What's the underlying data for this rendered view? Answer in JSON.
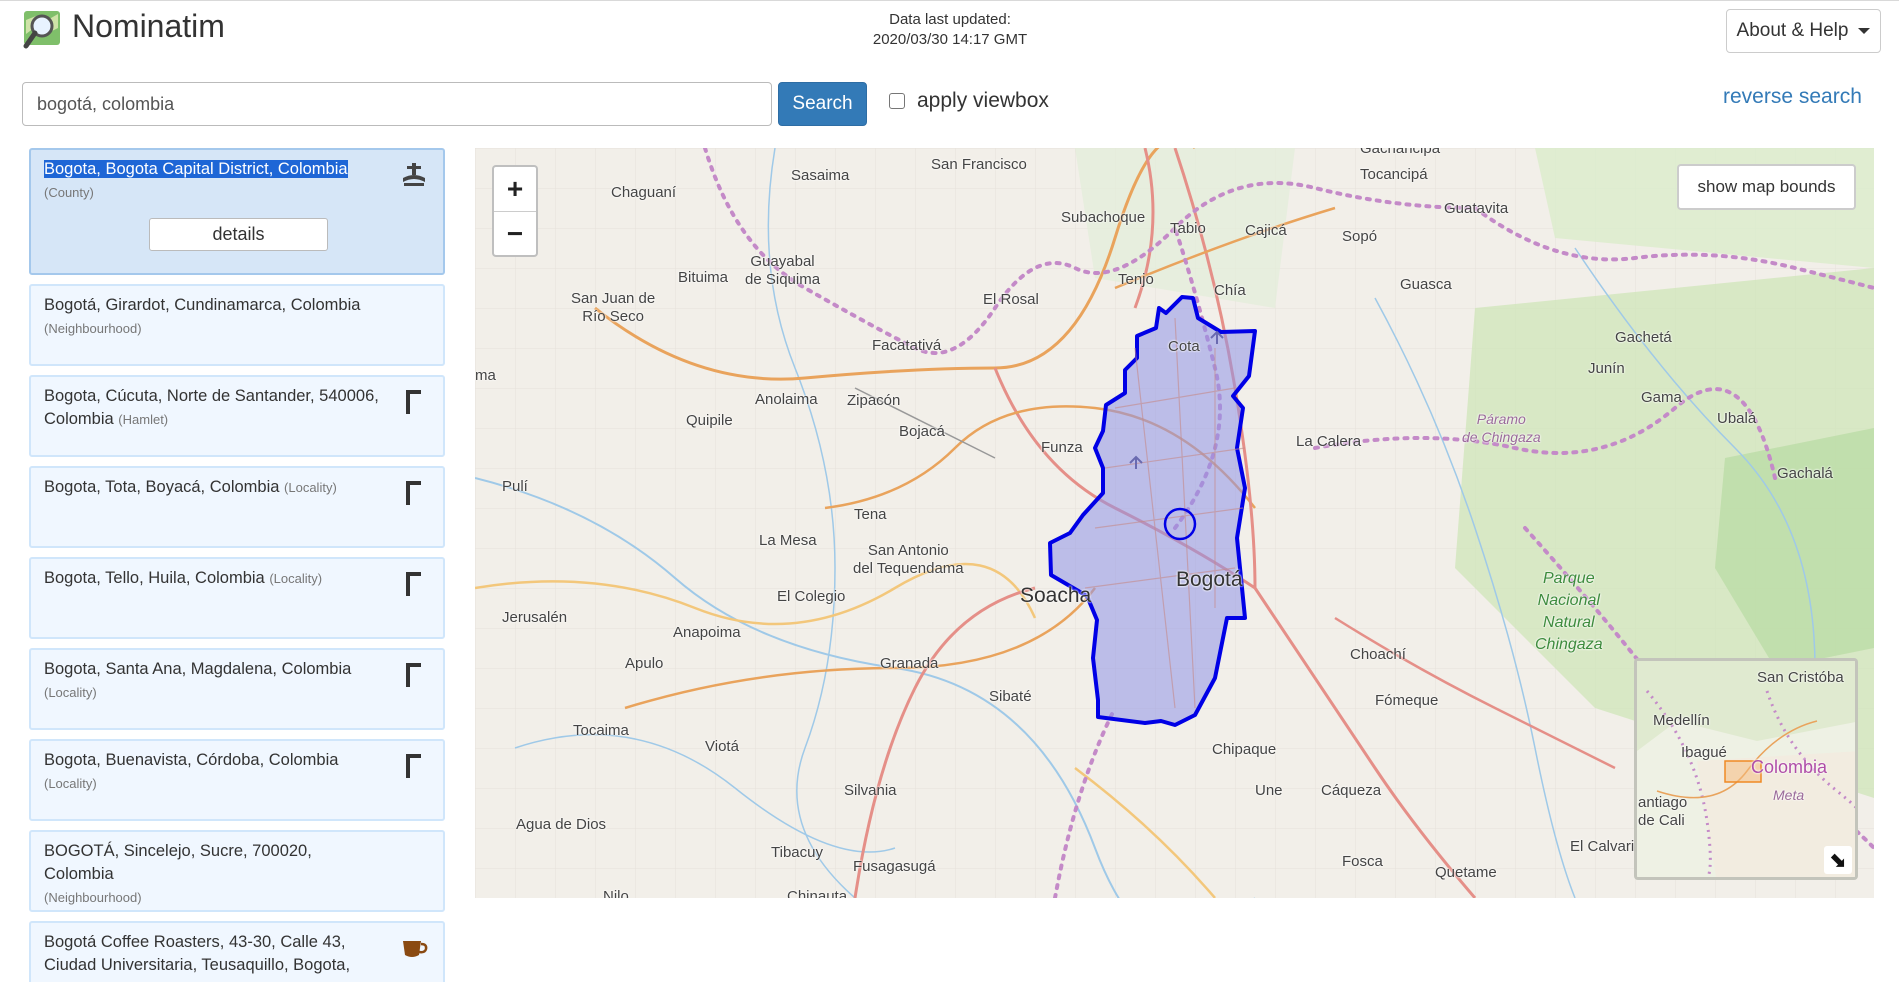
{
  "header": {
    "brand": "Nominatim",
    "updated_line1": "Data last updated:",
    "updated_line2": "2020/03/30 14:17 GMT",
    "about_label": "About & Help"
  },
  "search": {
    "query": "bogotá, colombia",
    "button_label": "Search",
    "viewbox_label": "apply viewbox",
    "viewbox_checked": false,
    "reverse_label": "reverse search"
  },
  "results": [
    {
      "name": "Bogota, Bogota Capital District, Colombia",
      "type": "(County)",
      "icon": "boundary-icon",
      "selected": true,
      "details_label": "details"
    },
    {
      "name": "Bogotá, Girardot, Cundinamarca, Colombia",
      "type": "(Neighbourhood)",
      "icon": ""
    },
    {
      "name": "Bogota, Cúcuta, Norte de Santander, 540006, Colombia",
      "type": "(Hamlet)",
      "icon": "place-flag-icon"
    },
    {
      "name": "Bogota, Tota, Boyacá, Colombia",
      "type": "(Locality)",
      "icon": "place-flag-icon"
    },
    {
      "name": "Bogota, Tello, Huila, Colombia",
      "type": "(Locality)",
      "icon": "place-flag-icon"
    },
    {
      "name": "Bogota, Santa Ana, Magdalena, Colombia",
      "type": "(Locality)",
      "icon": "place-flag-icon"
    },
    {
      "name": "Bogota, Buenavista, Córdoba, Colombia",
      "type": "(Locality)",
      "icon": "place-flag-icon"
    },
    {
      "name": "BOGOTÁ, Sincelejo, Sucre, 700020, Colombia",
      "type": "(Neighbourhood)",
      "icon": ""
    },
    {
      "name": "Bogotá Coffee Roasters, 43-30, Calle 43, Ciudad Universitaria, Teusaquillo, Bogota,",
      "type": "",
      "icon": "cafe-icon"
    }
  ],
  "map": {
    "zoom_in": "+",
    "zoom_out": "−",
    "show_bounds_label": "show map bounds",
    "labels": {
      "gachancipa": "Gachancipá",
      "san_francisco": "San Francisco",
      "sasaima": "Sasaima",
      "chaguani": "Chaguaní",
      "tocancipa": "Tocancipá",
      "subachoque": "Subachoque",
      "tabio": "Tabio",
      "cajica": "Cajicá",
      "sopo": "Sopó",
      "guatavita": "Guatavita",
      "bituima": "Bituima",
      "guayabal": "Guayabal\nde Siquima",
      "san_juan": "San Juan de\nRío Seco",
      "el_rosal": "El Rosal",
      "tenjo": "Tenjo",
      "chia": "Chía",
      "guasca": "Guasca",
      "ma": "ma",
      "facatativa": "Facatativá",
      "cota": "Cota",
      "gacheta": "Gachetá",
      "junin": "Junín",
      "anolaima": "Anolaima",
      "zipacon": "Zipacón",
      "gama": "Gama",
      "quipile": "Quipile",
      "bojaca": "Bojacá",
      "paramo": "Páramo\nde Chingaza",
      "ubala": "Ubalá",
      "funza": "Funza",
      "la_calera": "La Calera",
      "gachala": "Gachalá",
      "puli": "Pulí",
      "tena": "Tena",
      "la_mesa": "La Mesa",
      "san_antonio": "San Antonio\ndel Tequendama",
      "parque": "Parque\nNacional\nNatural\nChingaza",
      "soacha": "Soacha",
      "bogota": "Bogotá",
      "el_colegio": "El Colegio",
      "jerusalen": "Jerusalén",
      "anapoima": "Anapoima",
      "choachi": "Choachí",
      "apulo": "Apulo",
      "granada": "Granada",
      "sibate": "Sibaté",
      "fomeque": "Fómeque",
      "tocaima": "Tocaima",
      "viota": "Viotá",
      "chipaque": "Chipaque",
      "silvania": "Silvania",
      "une": "Une",
      "caqueza": "Cáqueza",
      "agua_de_dios": "Agua de Dios",
      "tibacuy": "Tibacuy",
      "fusagasuga": "Fusagasugá",
      "fosca": "Fosca",
      "quetame": "Quetame",
      "el_calvario": "El Calvari",
      "nilo": "Nilo",
      "chinauta": "Chinauta"
    },
    "minimap": {
      "san_cristobal": "San Cristóba",
      "medellin": "Medellín",
      "ibague": "Ibagué",
      "colombia": "Colombia",
      "meta": "Meta",
      "cali": "antiago\nde Cali",
      "toggle": "⬊"
    }
  }
}
